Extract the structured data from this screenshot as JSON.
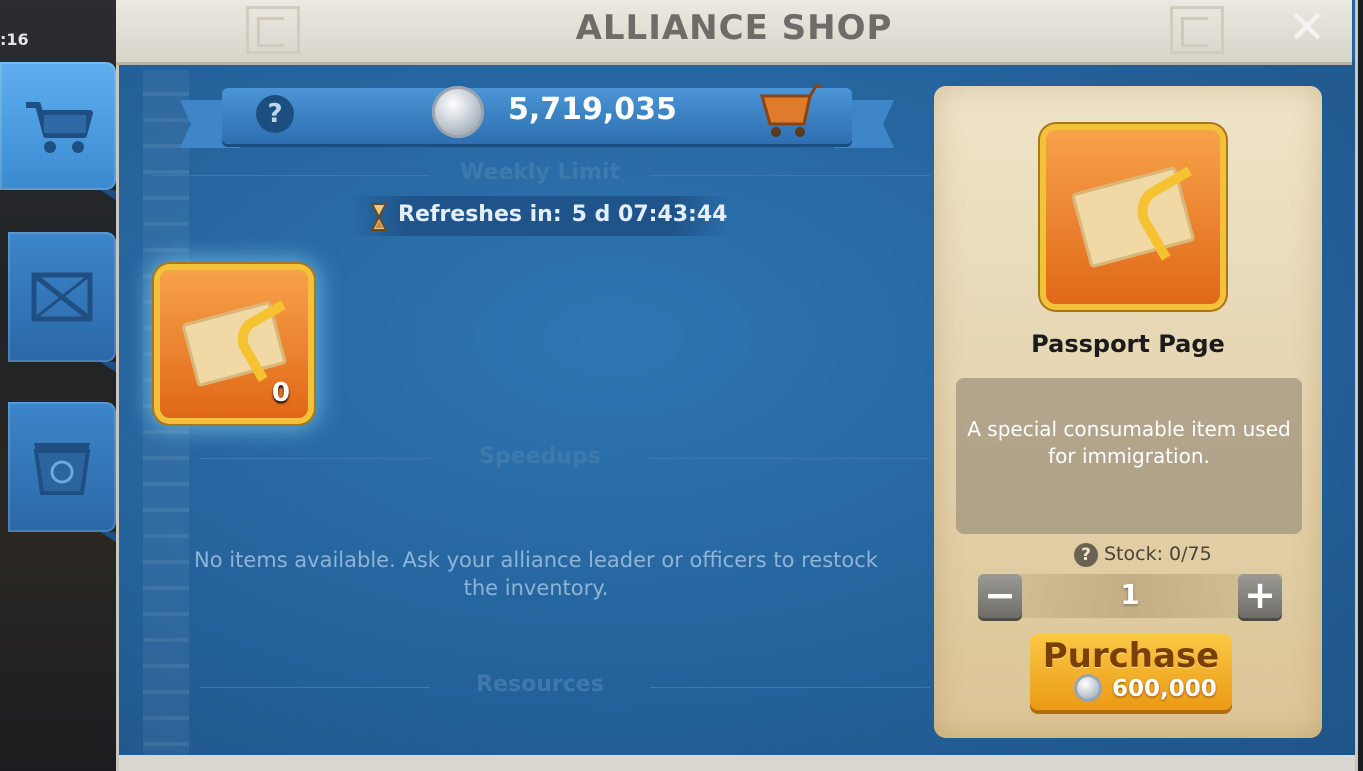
{
  "status_clock": ":16",
  "window": {
    "title": "ALLIANCE SHOP"
  },
  "currency": {
    "balance": "5,719,035"
  },
  "sections": {
    "weekly": "Weekly Limit",
    "speedups": "Speedups",
    "resources": "Resources"
  },
  "refresh": {
    "label": "Refreshes in:",
    "time": "5 d 07:43:44"
  },
  "weekly_item": {
    "owned_count": "0"
  },
  "empty_message": "No items available. Ask your alliance leader or officers to restock the inventory.",
  "detail": {
    "name": "Passport Page",
    "description": "A special consumable item used for immigration.",
    "stock": "Stock: 0/75",
    "quantity": "1",
    "purchase_label": "Purchase",
    "price": "600,000"
  },
  "colors": {
    "panel_blue": "#25629a",
    "tile_orange": "#e06818",
    "gold_button": "#fbc845"
  },
  "icons": [
    "shop-cart-icon",
    "crate-icon",
    "recycle-box-icon",
    "help-icon",
    "silver-coin-icon",
    "cart-icon",
    "hourglass-icon",
    "passport-page-icon",
    "close-icon",
    "minus-icon",
    "plus-icon"
  ]
}
